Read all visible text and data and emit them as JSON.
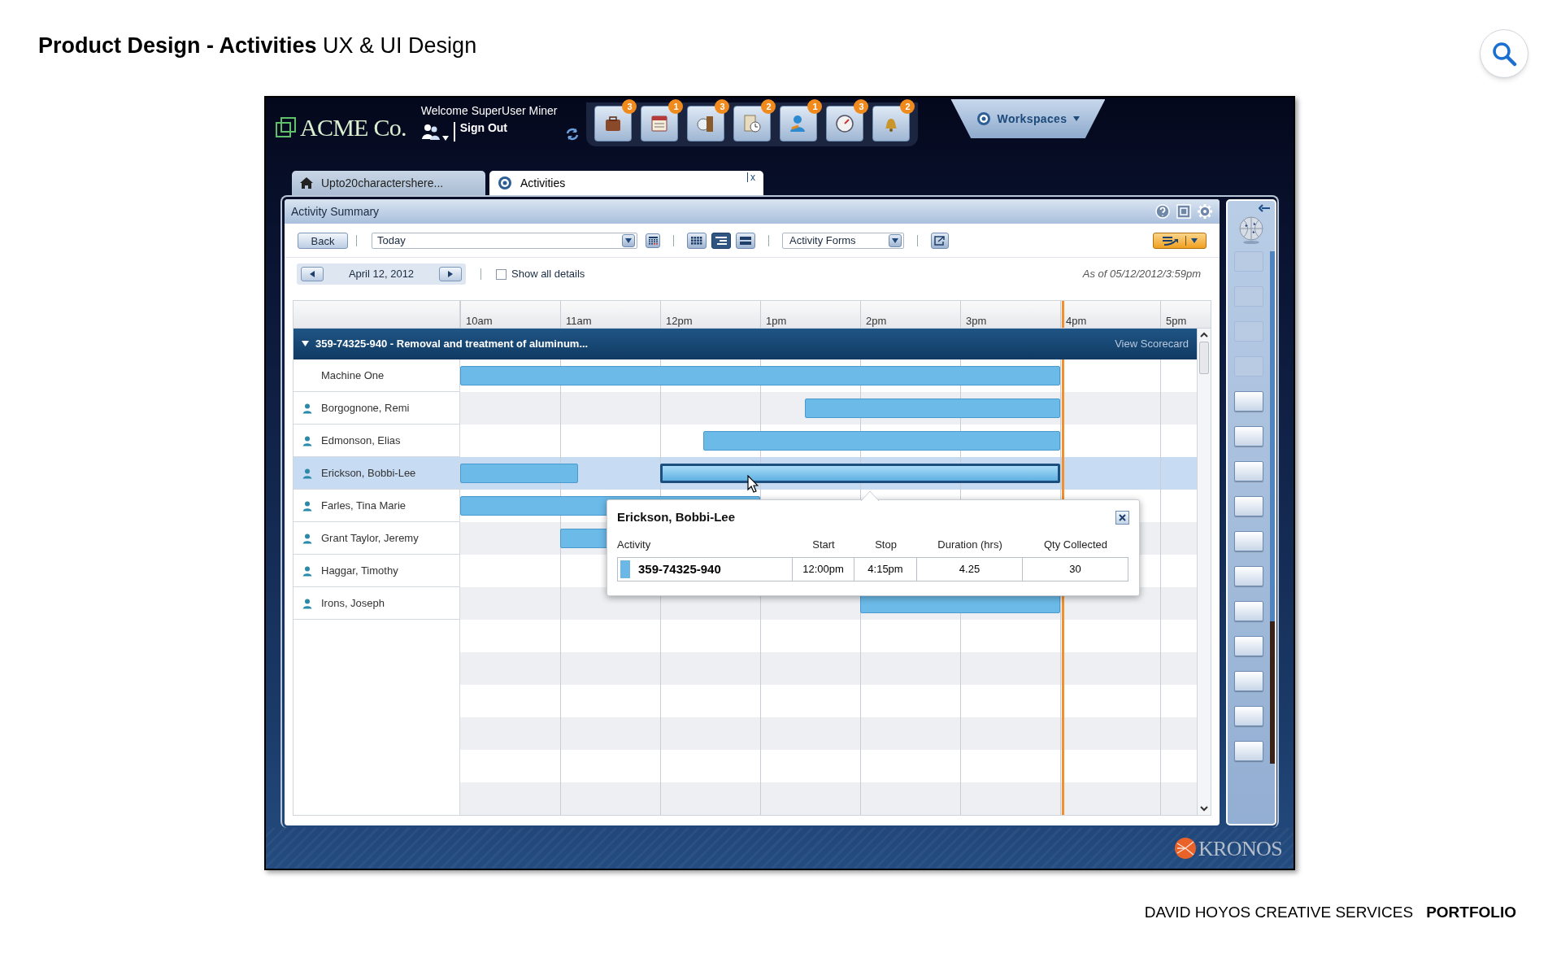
{
  "page_title": {
    "bold": "Product Design - Activities",
    "rest": "UX & UI Design"
  },
  "app": {
    "logo": "ACME Co.",
    "welcome": "Welcome SuperUser Miner",
    "sign_out": "Sign Out",
    "launch_icons": [
      {
        "kind": "briefcase",
        "badge": "3"
      },
      {
        "kind": "calendar",
        "badge": "1"
      },
      {
        "kind": "door",
        "badge": "3"
      },
      {
        "kind": "timesheet",
        "badge": "2"
      },
      {
        "kind": "person",
        "badge": "1"
      },
      {
        "kind": "gauge",
        "badge": "3"
      },
      {
        "kind": "bell",
        "badge": "2"
      }
    ],
    "workspaces": "Workspaces",
    "tabs": [
      {
        "kind": "home",
        "label": "Upto20charactershere...",
        "selected": false
      },
      {
        "kind": "activities",
        "label": "Activities",
        "selected": true,
        "close": "x"
      }
    ],
    "panel": {
      "title": "Activity Summary",
      "toolbar": {
        "back": "Back",
        "date_range": "Today",
        "view_modes": [
          {
            "kind": "grid",
            "selected": false
          },
          {
            "kind": "gantt",
            "selected": true
          },
          {
            "kind": "rows",
            "selected": false
          }
        ],
        "forms": "Activity Forms"
      },
      "date": "April 12, 2012",
      "show_all_details": {
        "label": "Show all details",
        "checked": false
      },
      "as_of": "As of 05/12/2012/3:59pm",
      "timeline": {
        "group": {
          "title": "359-74325-940 - Removal and treatment of aluminum...",
          "expanded": true,
          "link": "View Scorecard"
        },
        "hours": [
          "10am",
          "11am",
          "12pm",
          "1pm",
          "2pm",
          "3pm",
          "4pm",
          "5pm"
        ],
        "rows": [
          {
            "kind": "machine",
            "name": "Machine One",
            "selected": false,
            "bars": [
              {
                "selected": false
              }
            ]
          },
          {
            "kind": "person",
            "name": "Borgognone, Remi",
            "selected": false,
            "bars": [
              {
                "selected": false
              }
            ]
          },
          {
            "kind": "person",
            "name": "Edmonson, Elias",
            "selected": false,
            "bars": [
              {
                "selected": false
              }
            ]
          },
          {
            "kind": "person",
            "name": "Erickson, Bobbi-Lee",
            "selected": true,
            "bars": [
              {
                "selected": false
              },
              {
                "selected": true
              }
            ]
          },
          {
            "kind": "person",
            "name": "Farles, Tina Marie",
            "selected": false,
            "bars": [
              {
                "selected": false
              }
            ]
          },
          {
            "kind": "person",
            "name": "Grant Taylor, Jeremy",
            "selected": false,
            "bars": [
              {
                "selected": false
              }
            ]
          },
          {
            "kind": "person",
            "name": "Haggar, Timothy",
            "selected": false
          },
          {
            "kind": "person",
            "name": "Irons, Joseph",
            "selected": false,
            "bars": [
              {
                "selected": false
              }
            ]
          }
        ]
      },
      "popup": {
        "title": "Erickson, Bobbi-Lee",
        "columns": [
          "Activity",
          "Start",
          "Stop",
          "Duration (hrs)",
          "Qty Collected"
        ],
        "row": {
          "color": "#6bb8e6",
          "cells": [
            "359-74325-940",
            "12:00pm",
            "4:15pm",
            "4.25",
            "30"
          ]
        }
      }
    },
    "sidebar": {
      "slots": [
        {
          "disabled": true
        },
        {
          "disabled": true
        },
        {
          "disabled": true
        },
        {
          "disabled": true
        },
        {
          "disabled": false
        },
        {
          "disabled": false
        },
        {
          "disabled": false
        },
        {
          "disabled": false
        },
        {
          "disabled": false
        },
        {
          "disabled": false
        },
        {
          "disabled": false
        },
        {
          "disabled": false
        },
        {
          "disabled": false
        },
        {
          "disabled": false
        },
        {
          "disabled": false
        }
      ]
    },
    "brand": "KRONOS"
  },
  "footer": {
    "studio": "DAVID HOYOS CREATIVE SERVICES",
    "section": "PORTFOLIO"
  }
}
